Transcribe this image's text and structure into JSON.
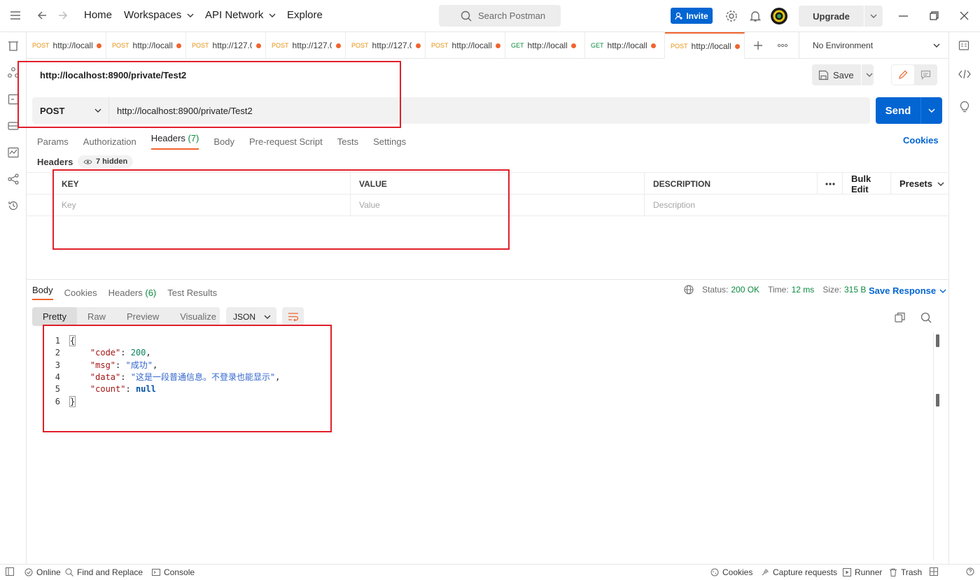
{
  "topbar": {
    "nav": [
      "Home",
      "Workspaces",
      "API Network",
      "Explore"
    ],
    "search_placeholder": "Search Postman",
    "invite_label": "Invite",
    "upgrade_label": "Upgrade"
  },
  "tabs": [
    {
      "method": "POST",
      "url": "http://localh"
    },
    {
      "method": "POST",
      "url": "http://localh"
    },
    {
      "method": "POST",
      "url": "http://127.0"
    },
    {
      "method": "POST",
      "url": "http://127.0"
    },
    {
      "method": "POST",
      "url": "http://127.0"
    },
    {
      "method": "POST",
      "url": "http://localh"
    },
    {
      "method": "GET",
      "url": "http://localhc"
    },
    {
      "method": "GET",
      "url": "http://localhc"
    },
    {
      "method": "POST",
      "url": "http://localh"
    }
  ],
  "environment": "No Environment",
  "request": {
    "title": "http://localhost:8900/private/Test2",
    "save_label": "Save",
    "method": "POST",
    "url": "http://localhost:8900/private/Test2",
    "send_label": "Send",
    "tabs": {
      "params": "Params",
      "authorization": "Authorization",
      "headers": "Headers",
      "headers_count": "(7)",
      "body": "Body",
      "prerequest": "Pre-request Script",
      "tests": "Tests",
      "settings": "Settings"
    },
    "cookies_label": "Cookies",
    "headers_label": "Headers",
    "hidden_badge": "7 hidden",
    "table": {
      "key_header": "KEY",
      "value_header": "VALUE",
      "description_header": "DESCRIPTION",
      "bulk_edit": "Bulk Edit",
      "presets": "Presets",
      "key_placeholder": "Key",
      "value_placeholder": "Value",
      "description_placeholder": "Description"
    }
  },
  "response": {
    "tabs": {
      "body": "Body",
      "cookies": "Cookies",
      "headers": "Headers",
      "headers_count": "(6)",
      "test_results": "Test Results"
    },
    "status_label": "Status:",
    "status_value": "200 OK",
    "time_label": "Time:",
    "time_value": "12 ms",
    "size_label": "Size:",
    "size_value": "315 B",
    "save_response": "Save Response",
    "formats": [
      "Pretty",
      "Raw",
      "Preview",
      "Visualize"
    ],
    "format_type": "JSON",
    "code": {
      "brace_open": "{",
      "brace_close": "}",
      "code_key": "\"code\"",
      "code_val": "200",
      "msg_key": "\"msg\"",
      "msg_val": "\"成功\"",
      "data_key": "\"data\"",
      "data_val": "\"这是一段普通信息。不登录也能显示\"",
      "count_key": "\"count\"",
      "count_val": "null"
    },
    "line_numbers": [
      "1",
      "2",
      "3",
      "4",
      "5",
      "6"
    ]
  },
  "statusbar": {
    "online": "Online",
    "find_replace": "Find and Replace",
    "console": "Console",
    "cookies": "Cookies",
    "capture": "Capture requests",
    "runner": "Runner",
    "trash": "Trash"
  },
  "colors": {
    "accent_orange": "#f0652f",
    "primary_blue": "#0265d2",
    "success_green": "#0b8a3e",
    "highlight_red": "#e0202a"
  }
}
